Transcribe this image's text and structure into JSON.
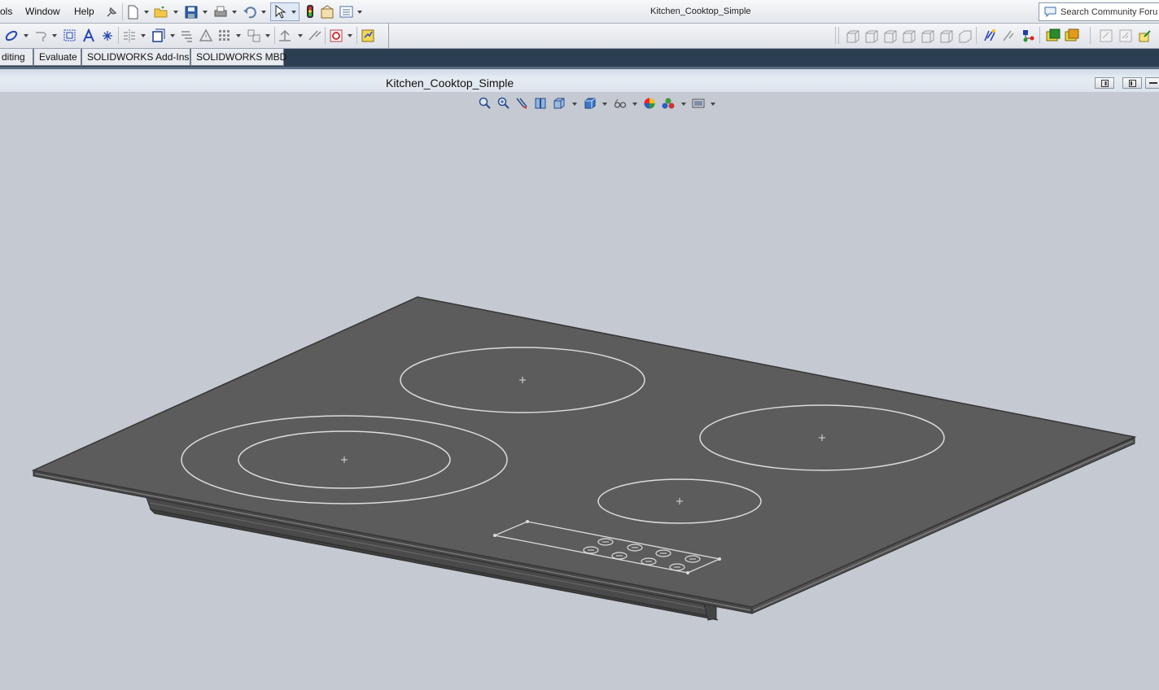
{
  "menu": {
    "tools": "ols",
    "window": "Window",
    "help": "Help"
  },
  "document_title": "Kitchen_Cooktop_Simple",
  "search": {
    "placeholder": "Search Community Foru"
  },
  "tabs": [
    {
      "label": "diting"
    },
    {
      "label": "Evaluate"
    },
    {
      "label": "SOLIDWORKS Add-Ins"
    },
    {
      "label": "SOLIDWORKS MBD"
    }
  ],
  "viewport": {
    "title": "Kitchen_Cooktop_Simple"
  },
  "icons": {
    "toolbar1": [
      "options-icon",
      "new-document-icon",
      "open-icon",
      "save-icon",
      "print-icon",
      "undo-icon",
      "select-icon",
      "rebuild-icon",
      "file-properties-icon",
      "options-list-icon"
    ],
    "toolbar2_left": [
      "sketch-entity-icon",
      "trim-icon",
      "offset-icon",
      "text-icon",
      "point-icon",
      "mirror-icon",
      "convert-icon",
      "relations-icon",
      "smart-dim-icon",
      "linear-pattern-icon",
      "move-icon",
      "reference-icon",
      "curve-icon",
      "section-icon",
      "instant3d-icon"
    ],
    "toolbar2_right": [
      "front-view-icon",
      "back-view-icon",
      "left-view-icon",
      "right-view-icon",
      "top-view-icon",
      "bottom-view-icon",
      "iso-view-icon",
      "smart-dimension-icon",
      "reference-geometry-icon",
      "curves-icon",
      "appearance-icon",
      "scene-icon",
      "render-icon",
      "render-tools-icon",
      "render-final-icon"
    ],
    "heads_up": [
      "zoom-to-fit-icon",
      "zoom-to-area-icon",
      "previous-view-icon",
      "section-view-icon",
      "view-orientation-icon",
      "display-style-icon",
      "hide-show-icon",
      "edit-appearance-icon",
      "apply-scene-icon",
      "view-settings-icon"
    ]
  },
  "colors": {
    "viewport_bg": "#c5c9d2",
    "glass": "#5c5c5c",
    "edge": "#3a3a3a",
    "burner_lines": "#d8d8d8",
    "tabstrip": "#2c3e52"
  }
}
